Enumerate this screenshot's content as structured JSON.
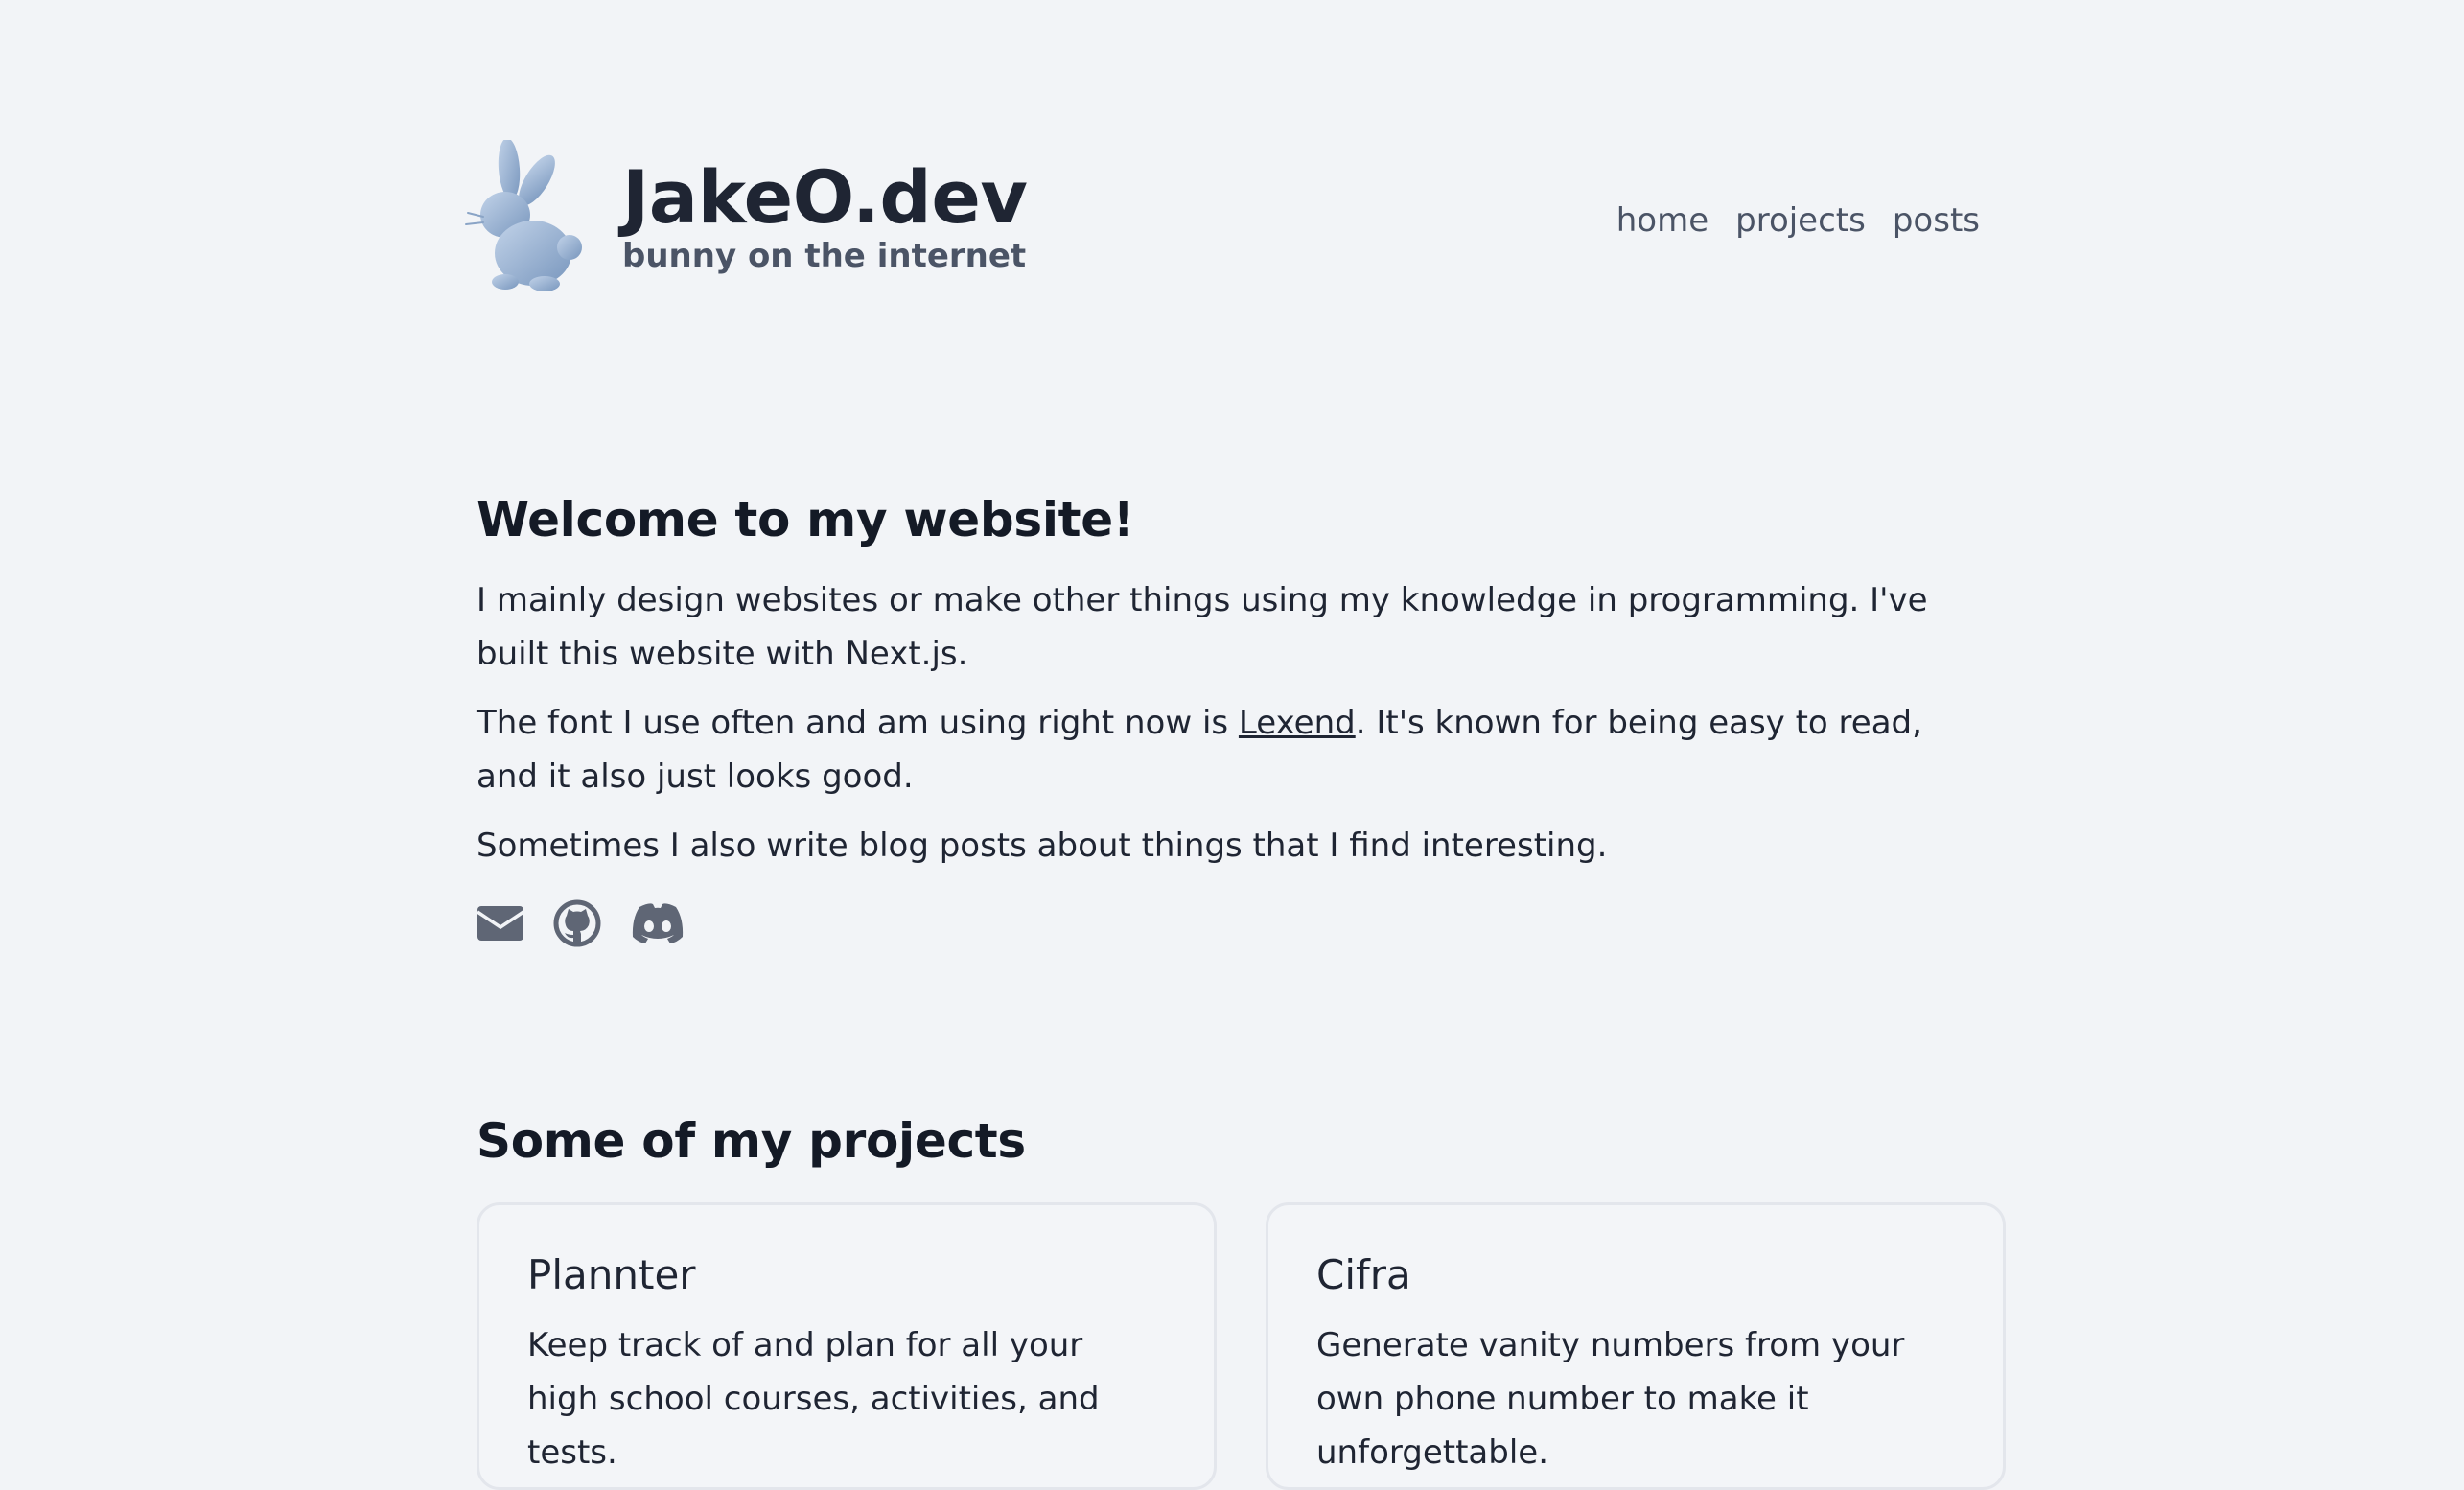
{
  "header": {
    "title": "JakeO.dev",
    "subtitle": "bunny on the internet",
    "logo_icon": "bunny-logo-icon"
  },
  "nav": {
    "items": [
      {
        "label": "home"
      },
      {
        "label": "projects"
      },
      {
        "label": "posts"
      }
    ]
  },
  "intro": {
    "heading": "Welcome to my website!",
    "p1": "I mainly design websites or make other things using my knowledge in programming. I've built this website with Next.js.",
    "p2_before": "The font I use often and am using right now is ",
    "p2_link": "Lexend",
    "p2_after": ". It's known for being easy to read, and it also just looks good.",
    "p3": "Sometimes I also write blog posts about things that I find interesting."
  },
  "socials": [
    {
      "icon": "mail-icon"
    },
    {
      "icon": "github-icon"
    },
    {
      "icon": "discord-icon"
    }
  ],
  "projects": {
    "heading": "Some of my projects",
    "items": [
      {
        "title": "Plannter",
        "description": "Keep track of and plan for all your high school courses, activities, and tests."
      },
      {
        "title": "Cifra",
        "description": "Generate vanity numbers from your own phone number to make it unforgettable."
      }
    ]
  },
  "colors": {
    "background": "#f2f4f7",
    "text": "#1f2533",
    "muted": "#4b5466",
    "icon": "#5f6675",
    "logo_light": "#b9cce4",
    "logo_dark": "#7e9cc2"
  }
}
